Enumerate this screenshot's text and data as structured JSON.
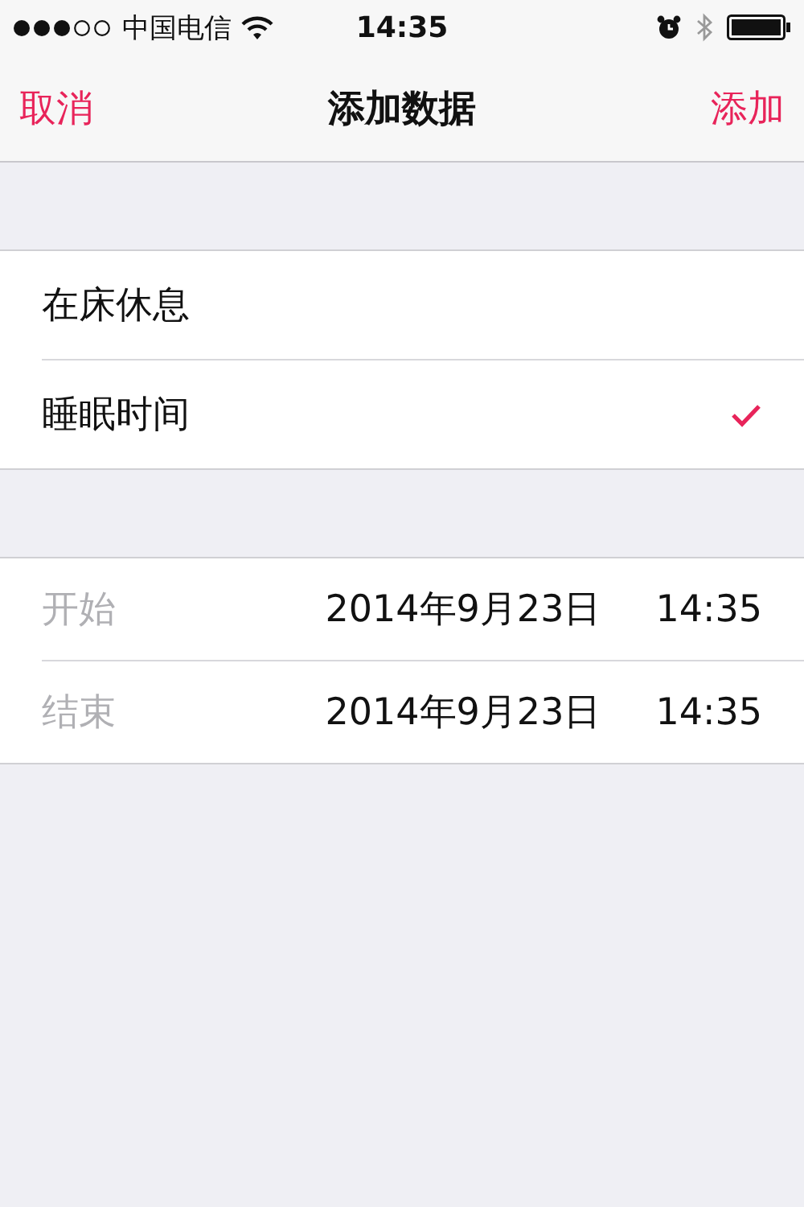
{
  "status_bar": {
    "carrier": "中国电信",
    "time": "14:35"
  },
  "nav": {
    "cancel": "取消",
    "title": "添加数据",
    "add": "添加"
  },
  "options": [
    {
      "label": "在床休息",
      "selected": false
    },
    {
      "label": "睡眠时间",
      "selected": true
    }
  ],
  "times": [
    {
      "label": "开始",
      "date": "2014年9月23日",
      "time": "14:35"
    },
    {
      "label": "结束",
      "date": "2014年9月23日",
      "time": "14:35"
    }
  ]
}
